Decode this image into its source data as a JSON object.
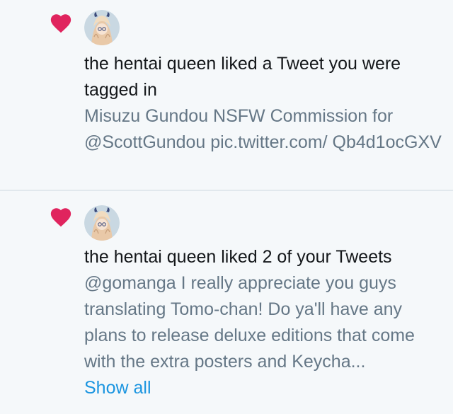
{
  "notifications": [
    {
      "icon": "heart-icon",
      "icon_color": "#e0245e",
      "avatar": "anime-avatar",
      "headline": "the hentai queen liked a Tweet you were tagged in",
      "tweet_text": "Misuzu Gundou NSFW Commission for @ScottGundou pic.twitter.com/ Qb4d1ocGXV"
    },
    {
      "icon": "heart-icon",
      "icon_color": "#e0245e",
      "avatar": "anime-avatar",
      "headline": "the hentai queen liked 2 of your Tweets",
      "tweet_text": "@gomanga I really appreciate you guys translating Tomo-chan! Do ya'll have any plans to release deluxe editions that come with the extra posters and Keycha...",
      "show_all_label": "Show all"
    }
  ],
  "colors": {
    "background": "#f5f8fa",
    "divider": "#e1e8ed",
    "link": "#1b95e0",
    "primary_text": "#14171a",
    "secondary_text": "#657786"
  }
}
